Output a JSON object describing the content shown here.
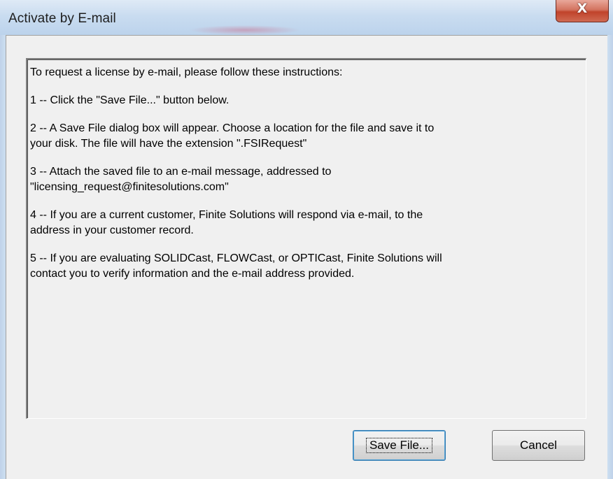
{
  "window": {
    "title": "Activate by E-mail",
    "close_glyph": "X"
  },
  "instructions": {
    "paragraphs": [
      "To request a license by e-mail, please follow these instructions:",
      "1 -- Click the \"Save File...\" button below.",
      "2 -- A Save File dialog box will appear. Choose a location for the file and save it to\nyour disk. The file will have the extension \".FSIRequest\"",
      "3 -- Attach the saved file to an e-mail message, addressed to\n\"licensing_request@finitesolutions.com\"",
      "4 -- If you are a current customer, Finite Solutions will respond via e-mail, to the\naddress in your customer record.",
      "5 -- If you are evaluating SOLIDCast, FLOWCast, or OPTICast, Finite Solutions will\ncontact you to verify information and the e-mail address provided."
    ]
  },
  "buttons": {
    "save_label": "Save File...",
    "cancel_label": "Cancel"
  },
  "colors": {
    "titlebar": "#c9dcf0",
    "close_button": "#c0432b",
    "dialog_background": "#f0f0f0",
    "default_button_border": "#3c7fb1"
  },
  "icons": {
    "close": "close-icon"
  }
}
